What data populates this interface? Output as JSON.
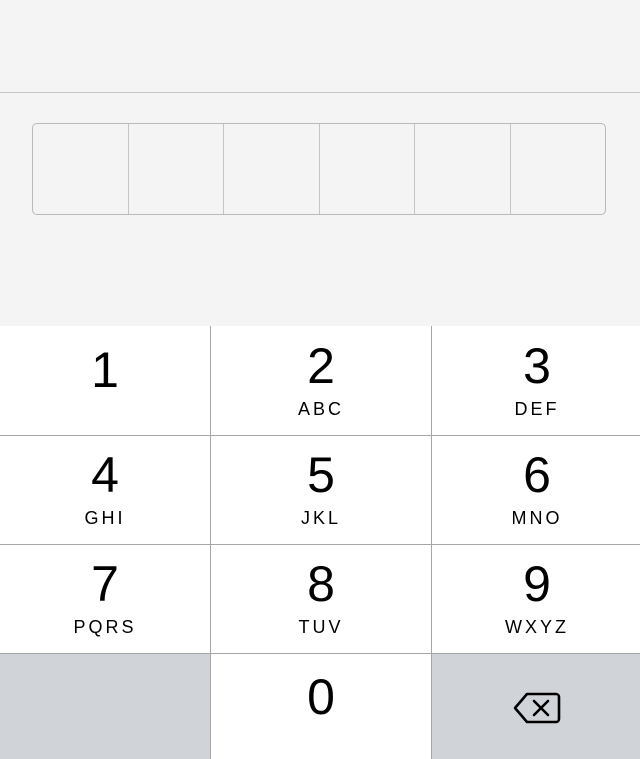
{
  "passcode": {
    "length": 6,
    "entered": 0
  },
  "keypad": {
    "keys": [
      {
        "digit": "1",
        "letters": ""
      },
      {
        "digit": "2",
        "letters": "ABC"
      },
      {
        "digit": "3",
        "letters": "DEF"
      },
      {
        "digit": "4",
        "letters": "GHI"
      },
      {
        "digit": "5",
        "letters": "JKL"
      },
      {
        "digit": "6",
        "letters": "MNO"
      },
      {
        "digit": "7",
        "letters": "PQRS"
      },
      {
        "digit": "8",
        "letters": "TUV"
      },
      {
        "digit": "9",
        "letters": "WXYZ"
      },
      {
        "digit": "0",
        "letters": ""
      }
    ],
    "delete_icon": "delete-backspace-icon"
  },
  "colors": {
    "background": "#f4f4f4",
    "key": "#ffffff",
    "key_dark": "#d0d3d8",
    "key_separator": "#a6a6a6"
  }
}
